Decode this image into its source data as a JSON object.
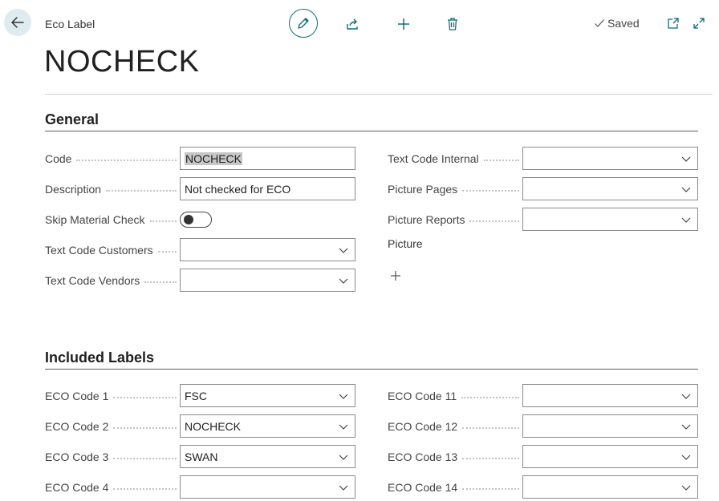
{
  "breadcrumb": "Eco Label",
  "title": "NOCHECK",
  "toolbar": {
    "status": "Saved"
  },
  "general": {
    "title": "General",
    "code_label": "Code",
    "code_value": "NOCHECK",
    "description_label": "Description",
    "description_value": "Not checked for ECO",
    "skip_label": "Skip Material Check",
    "skip_value": false,
    "text_code_customers_label": "Text Code Customers",
    "text_code_customers_value": "",
    "text_code_vendors_label": "Text Code Vendors",
    "text_code_vendors_value": "",
    "text_code_internal_label": "Text Code Internal",
    "text_code_internal_value": "",
    "picture_pages_label": "Picture Pages",
    "picture_pages_value": "",
    "picture_reports_label": "Picture Reports",
    "picture_reports_value": "",
    "picture_label": "Picture"
  },
  "included": {
    "title": "Included Labels",
    "left": [
      {
        "label": "ECO Code 1",
        "value": "FSC"
      },
      {
        "label": "ECO Code 2",
        "value": "NOCHECK"
      },
      {
        "label": "ECO Code 3",
        "value": "SWAN"
      },
      {
        "label": "ECO Code 4",
        "value": ""
      }
    ],
    "right": [
      {
        "label": "ECO Code 11",
        "value": ""
      },
      {
        "label": "ECO Code 12",
        "value": ""
      },
      {
        "label": "ECO Code 13",
        "value": ""
      },
      {
        "label": "ECO Code 14",
        "value": ""
      }
    ]
  },
  "colors": {
    "accent": "#0e6d7e",
    "back_bg": "#deecef",
    "selection": "#c7c7c7"
  }
}
